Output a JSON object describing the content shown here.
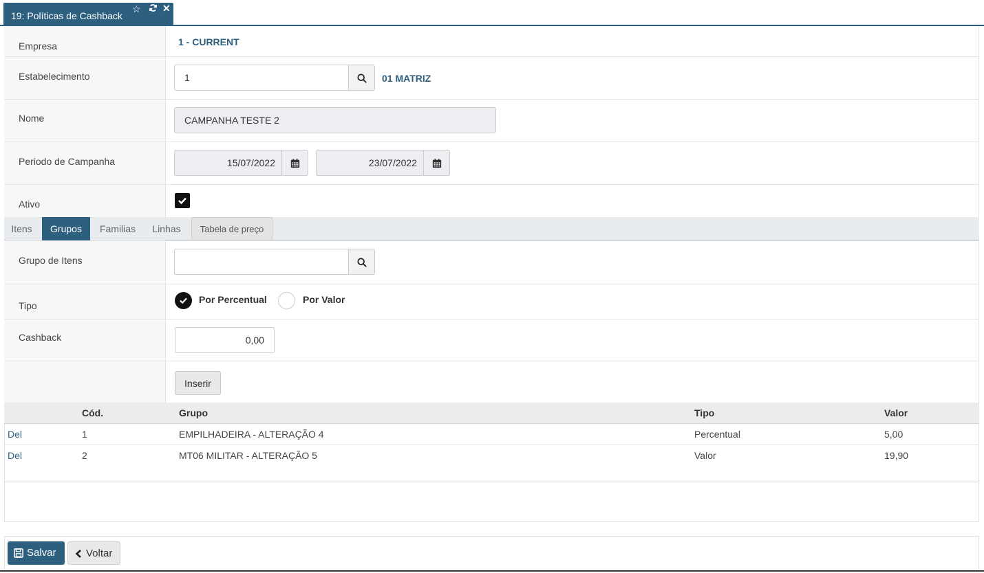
{
  "window_tab": {
    "title": "19: Políticas de Cashback",
    "star_icon": "star-icon",
    "refresh_icon": "refresh-icon",
    "close_icon": "close-icon"
  },
  "form": {
    "empresa": {
      "label": "Empresa",
      "value": "1 - CURRENT"
    },
    "estabelecimento": {
      "label": "Estabelecimento",
      "value": "1",
      "description": "01 MATRIZ"
    },
    "nome": {
      "label": "Nome",
      "value": "CAMPANHA TESTE 2"
    },
    "periodo": {
      "label": "Periodo de Campanha",
      "start": "15/07/2022",
      "end": "23/07/2022"
    },
    "ativo": {
      "label": "Ativo",
      "checked": true
    }
  },
  "tabs": [
    {
      "label": "Itens",
      "active": false
    },
    {
      "label": "Grupos",
      "active": true
    },
    {
      "label": "Familias",
      "active": false
    },
    {
      "label": "Linhas",
      "active": false
    },
    {
      "label": "Tabela de preço",
      "active": false
    }
  ],
  "grupos": {
    "grupo_label": "Grupo de Itens",
    "grupo_value": "",
    "tipo_label": "Tipo",
    "tipo_options": [
      "Por Percentual",
      "Por Valor"
    ],
    "tipo_selected": "Por Percentual",
    "cashback_label": "Cashback",
    "cashback_value": "0,00",
    "insert_label": "Inserir"
  },
  "table": {
    "headers": [
      "Cód.",
      "Grupo",
      "Tipo",
      "Valor"
    ],
    "rows": [
      {
        "action": "Del",
        "cod": "1",
        "grupo": "EMPILHADEIRA - ALTERAÇÃO 4",
        "tipo": "Percentual",
        "valor": "5,00"
      },
      {
        "action": "Del",
        "cod": "2",
        "grupo": "MT06 MILITAR - ALTERAÇÃO 5",
        "tipo": "Valor",
        "valor": "19,90"
      }
    ]
  },
  "footer": {
    "save_label": "Salvar",
    "back_label": "Voltar"
  },
  "colors": {
    "primary": "#2d5f7f",
    "label_bg": "#f7f7f7",
    "readonly_bg": "#eceef1"
  }
}
